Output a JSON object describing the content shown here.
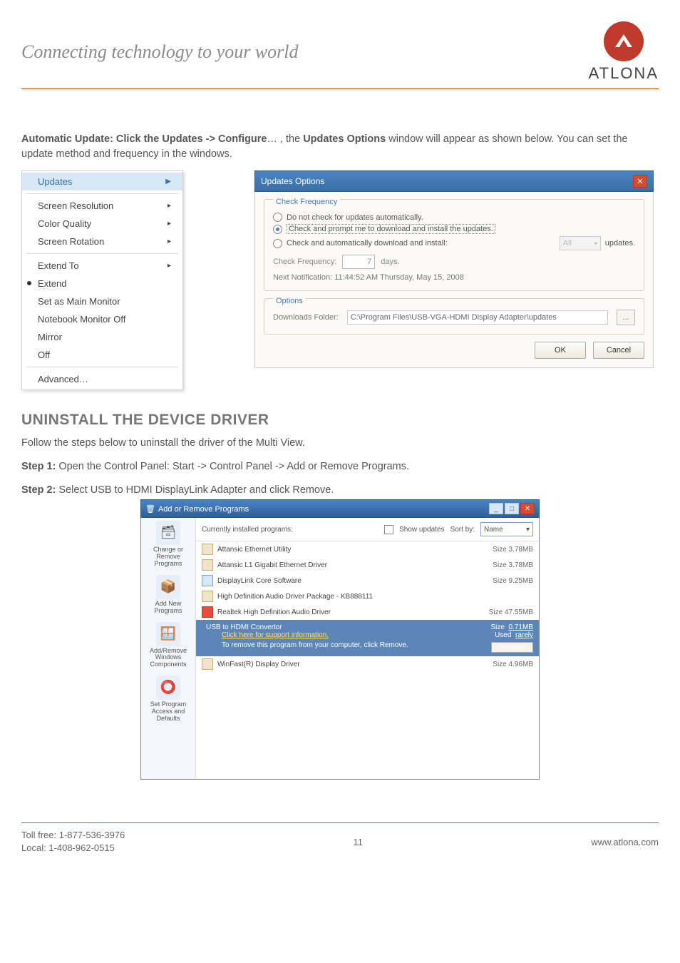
{
  "header": {
    "tagline": "Connecting technology to your world",
    "brand": "ATLONA"
  },
  "intro": {
    "b1": "Automatic Update: Click the Updates -> Configure",
    "t1": "… , the ",
    "b2": "Updates Options",
    "t2": " window will appear as shown below. You can set the update method and frequency in the windows."
  },
  "menu": {
    "updates": "Updates",
    "res": "Screen Resolution",
    "cq": "Color Quality",
    "rot": "Screen Rotation",
    "ext_to": "Extend To",
    "extend": "Extend",
    "main": "Set as Main Monitor",
    "nboff": "Notebook Monitor Off",
    "mirror": "Mirror",
    "off": "Off",
    "adv": "Advanced…"
  },
  "dialog": {
    "title": "Updates Options",
    "legend_freq": "Check Frequency",
    "r1": "Do not check for updates automatically.",
    "r2": "Check and prompt me to download and install the updates.",
    "r3": "Check and automatically download and install:",
    "r3_sel": "All",
    "r3_suffix": "updates.",
    "freq_label": "Check Frequency:",
    "freq_val": "7",
    "freq_unit": "days.",
    "notif": "Next Notification: 11:44:52 AM Thursday, May 15, 2008",
    "legend_opt": "Options",
    "dl_label": "Downloads Folder:",
    "dl_path": "C:\\Program Files\\USB-VGA-HDMI Display Adapter\\updates",
    "ok": "OK",
    "cancel": "Cancel"
  },
  "section": "UNINSTALL THE DEVICE DRIVER",
  "uninstall": {
    "l1": "Follow the steps below to uninstall the driver of the Multi View.",
    "s1b": "Step 1:",
    "s1": " Open the Control Panel: Start -> Control Panel -> Add or Remove Programs.",
    "s2b": "Step 2:",
    "s2": " Select USB to HDMI DisplayLink Adapter and click Remove."
  },
  "arp": {
    "title": "Add or Remove Programs",
    "side": {
      "change": "Change or\nRemove\nPrograms",
      "addnew": "Add New\nPrograms",
      "addwin": "Add/Remove\nWindows\nComponents",
      "setprog": "Set Program\nAccess and\nDefaults"
    },
    "top": {
      "curr": "Currently installed programs:",
      "showup": "Show updates",
      "sortby": "Sort by:",
      "sortval": "Name"
    },
    "rows": [
      {
        "name": "Attansic Ethernet Utility",
        "size": "Size    3.78MB"
      },
      {
        "name": "Attansic L1 Gigabit Ethernet Driver",
        "size": "Size    3.78MB"
      },
      {
        "name": "DisplayLink Core Software",
        "size": "Size    9.25MB"
      },
      {
        "name": "High Definition Audio Driver Package - KB888111",
        "size": ""
      },
      {
        "name": "Realtek High Definition Audio Driver",
        "size": "Size   47.55MB"
      }
    ],
    "selected": {
      "name": "USB to HDMI Convertor",
      "link": "Click here for support information.",
      "sub": "To remove this program from your computer, click Remove.",
      "size": "Size",
      "sizev": "0.71MB",
      "used": "Used",
      "usedv": "rarely",
      "remove": "Remove"
    },
    "after": {
      "name": "WinFast(R) Display Driver",
      "size": "Size    4.96MB"
    }
  },
  "footer": {
    "toll": "Toll free: 1-877-536-3976",
    "local": "Local: 1-408-962-0515",
    "page": "11",
    "url": "www.atlona.com"
  }
}
